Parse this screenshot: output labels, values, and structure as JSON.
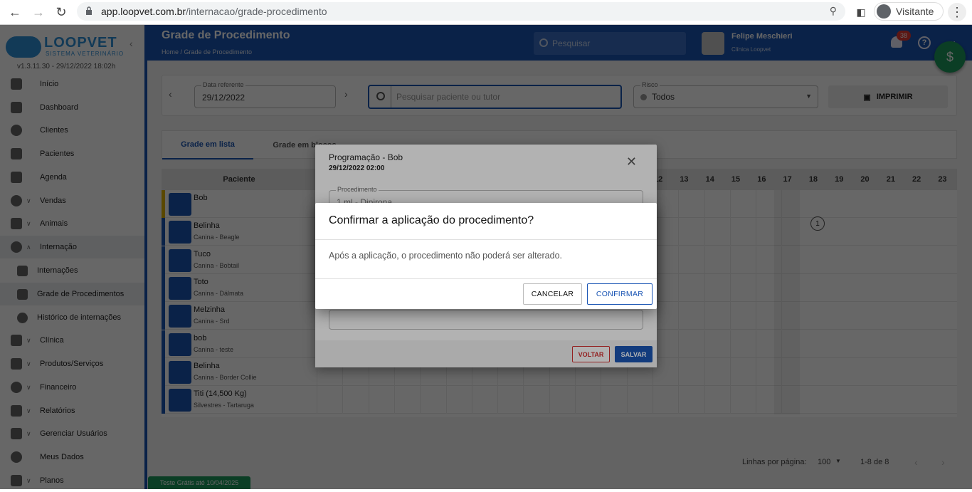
{
  "browser": {
    "url_host": "app.loopvet.com.br",
    "url_path": "/internacao/grade-procedimento",
    "profile_label": "Visitante"
  },
  "sidebar": {
    "brand": "LOOPVET",
    "brand_sub": "SISTEMA VETERINÁRIO",
    "version": "v1.3.11.30 - 29/12/2022 18:02h",
    "items": [
      {
        "label": "Início",
        "icon": "home-icon"
      },
      {
        "label": "Dashboard",
        "icon": "dashboard-icon"
      },
      {
        "label": "Clientes",
        "icon": "person-icon"
      },
      {
        "label": "Pacientes",
        "icon": "paw-icon"
      },
      {
        "label": "Agenda",
        "icon": "calendar-icon"
      },
      {
        "label": "Vendas",
        "icon": "money-icon"
      },
      {
        "label": "Animais",
        "icon": "folder-icon"
      },
      {
        "label": "Internação",
        "icon": "hospital-icon"
      },
      {
        "label": "Internações",
        "icon": "plus-box-icon"
      },
      {
        "label": "Grade de Procedimentos",
        "icon": "tune-icon"
      },
      {
        "label": "Histórico de internações",
        "icon": "history-icon"
      },
      {
        "label": "Clínica",
        "icon": "clinic-icon"
      },
      {
        "label": "Produtos/Serviços",
        "icon": "list-icon"
      },
      {
        "label": "Financeiro",
        "icon": "money-icon"
      },
      {
        "label": "Relatórios",
        "icon": "chart-icon"
      },
      {
        "label": "Gerenciar Usuários",
        "icon": "users-icon"
      },
      {
        "label": "Meus Dados",
        "icon": "account-icon"
      },
      {
        "label": "Planos",
        "icon": "plans-icon"
      }
    ]
  },
  "topbar": {
    "title": "Grade de Procedimento",
    "breadcrumb": "Home   /   Grade de Procedimento",
    "search_placeholder": "Pesquisar",
    "user_name": "Felipe Meschieri",
    "user_clinic": "Clínica Loopvet",
    "notifications": "38"
  },
  "filters": {
    "date_label": "Data referente",
    "date_value": "29/12/2022",
    "search_placeholder": "Pesquisar paciente ou tutor",
    "risk_label": "Risco",
    "risk_value": "Todos",
    "print_label": "IMPRIMIR"
  },
  "tabs": [
    "Grade em lista",
    "Grade em blocos"
  ],
  "grid": {
    "patient_header": "Paciente",
    "hours": [
      "12",
      "13",
      "14",
      "15",
      "16",
      "17",
      "18",
      "19",
      "20",
      "21",
      "22",
      "23"
    ],
    "marker_value": "1",
    "rows": [
      {
        "name": "Bob",
        "species": ""
      },
      {
        "name": "Belinha",
        "species": "Canina - Beagle"
      },
      {
        "name": "Tuco",
        "species": "Canina - Bobtail"
      },
      {
        "name": "Toto",
        "species": "Canina - Dálmata"
      },
      {
        "name": "Melzinha",
        "species": "Canina - Srd"
      },
      {
        "name": "bob",
        "species": "Canina - teste"
      },
      {
        "name": "Belinha",
        "species": "Canina - Border Collie"
      },
      {
        "name": "Titi (14,500 Kg)",
        "species": "Silvestres - Tartaruga"
      }
    ]
  },
  "pager": {
    "rows_label": "Linhas por página:",
    "rows_value": "100",
    "range": "1-8 de 8"
  },
  "dialog_procedure": {
    "title": "Programação - Bob",
    "datetime": "29/12/2022 02:00",
    "field_label": "Procedimento",
    "field_value": "1 ml - Dipirona",
    "back_label": "VOLTAR",
    "save_label": "SALVAR"
  },
  "dialog_confirm": {
    "title": "Confirmar a aplicação do procedimento?",
    "message": "Após a aplicação, o procedimento não poderá ser alterado.",
    "cancel_label": "CANCELAR",
    "confirm_label": "CONFIRMAR"
  },
  "trial_banner": "Teste Grátis até 10/04/2025",
  "colors": {
    "primary": "#1a55b4",
    "danger": "#d32f2f",
    "success": "#1e9a5c"
  }
}
